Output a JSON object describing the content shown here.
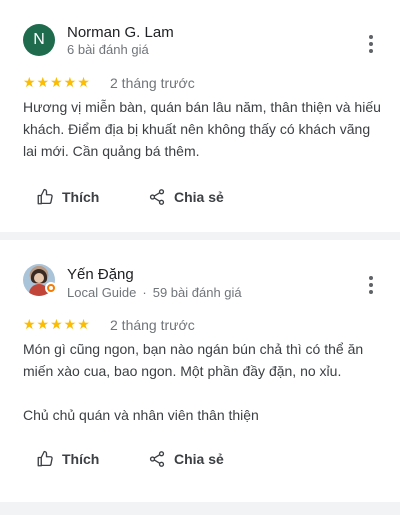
{
  "reviews": [
    {
      "avatar_letter": "N",
      "author": "Norman G. Lam",
      "local_guide": "",
      "review_count": "6 bài đánh giá",
      "stars": "★★★★★",
      "rating": 5,
      "time": "2 tháng trước",
      "text": [
        "Hương vị miễn bàn, quán bán lâu năm, thân thiện và hiếu khách. Điểm địa bị khuất nên không thấy có khách vãng lai mới. Cần quảng bá thêm."
      ],
      "like_label": "Thích",
      "share_label": "Chia sẻ"
    },
    {
      "author": "Yến Đặng",
      "local_guide": "Local Guide",
      "separator": "·",
      "review_count": "59 bài đánh giá",
      "stars": "★★★★★",
      "rating": 5,
      "time": "2 tháng trước",
      "text": [
        "Món gì cũng ngon, bạn nào ngán bún chả thì có thể ăn miến xào cua, bao ngon. Một phần đầy đặn, no xỉu.",
        "Chủ chủ quán và nhân viên thân thiện"
      ],
      "like_label": "Thích",
      "share_label": "Chia sẻ"
    }
  ],
  "colors": {
    "star": "#fbbc04",
    "avatar_bg": "#1e6b4e",
    "secondary_text": "#70757a",
    "local_guide_badge": "#f57c00"
  },
  "icons": {
    "like": "thumbs-up-icon",
    "share": "share-icon",
    "more": "more-vert-icon"
  }
}
